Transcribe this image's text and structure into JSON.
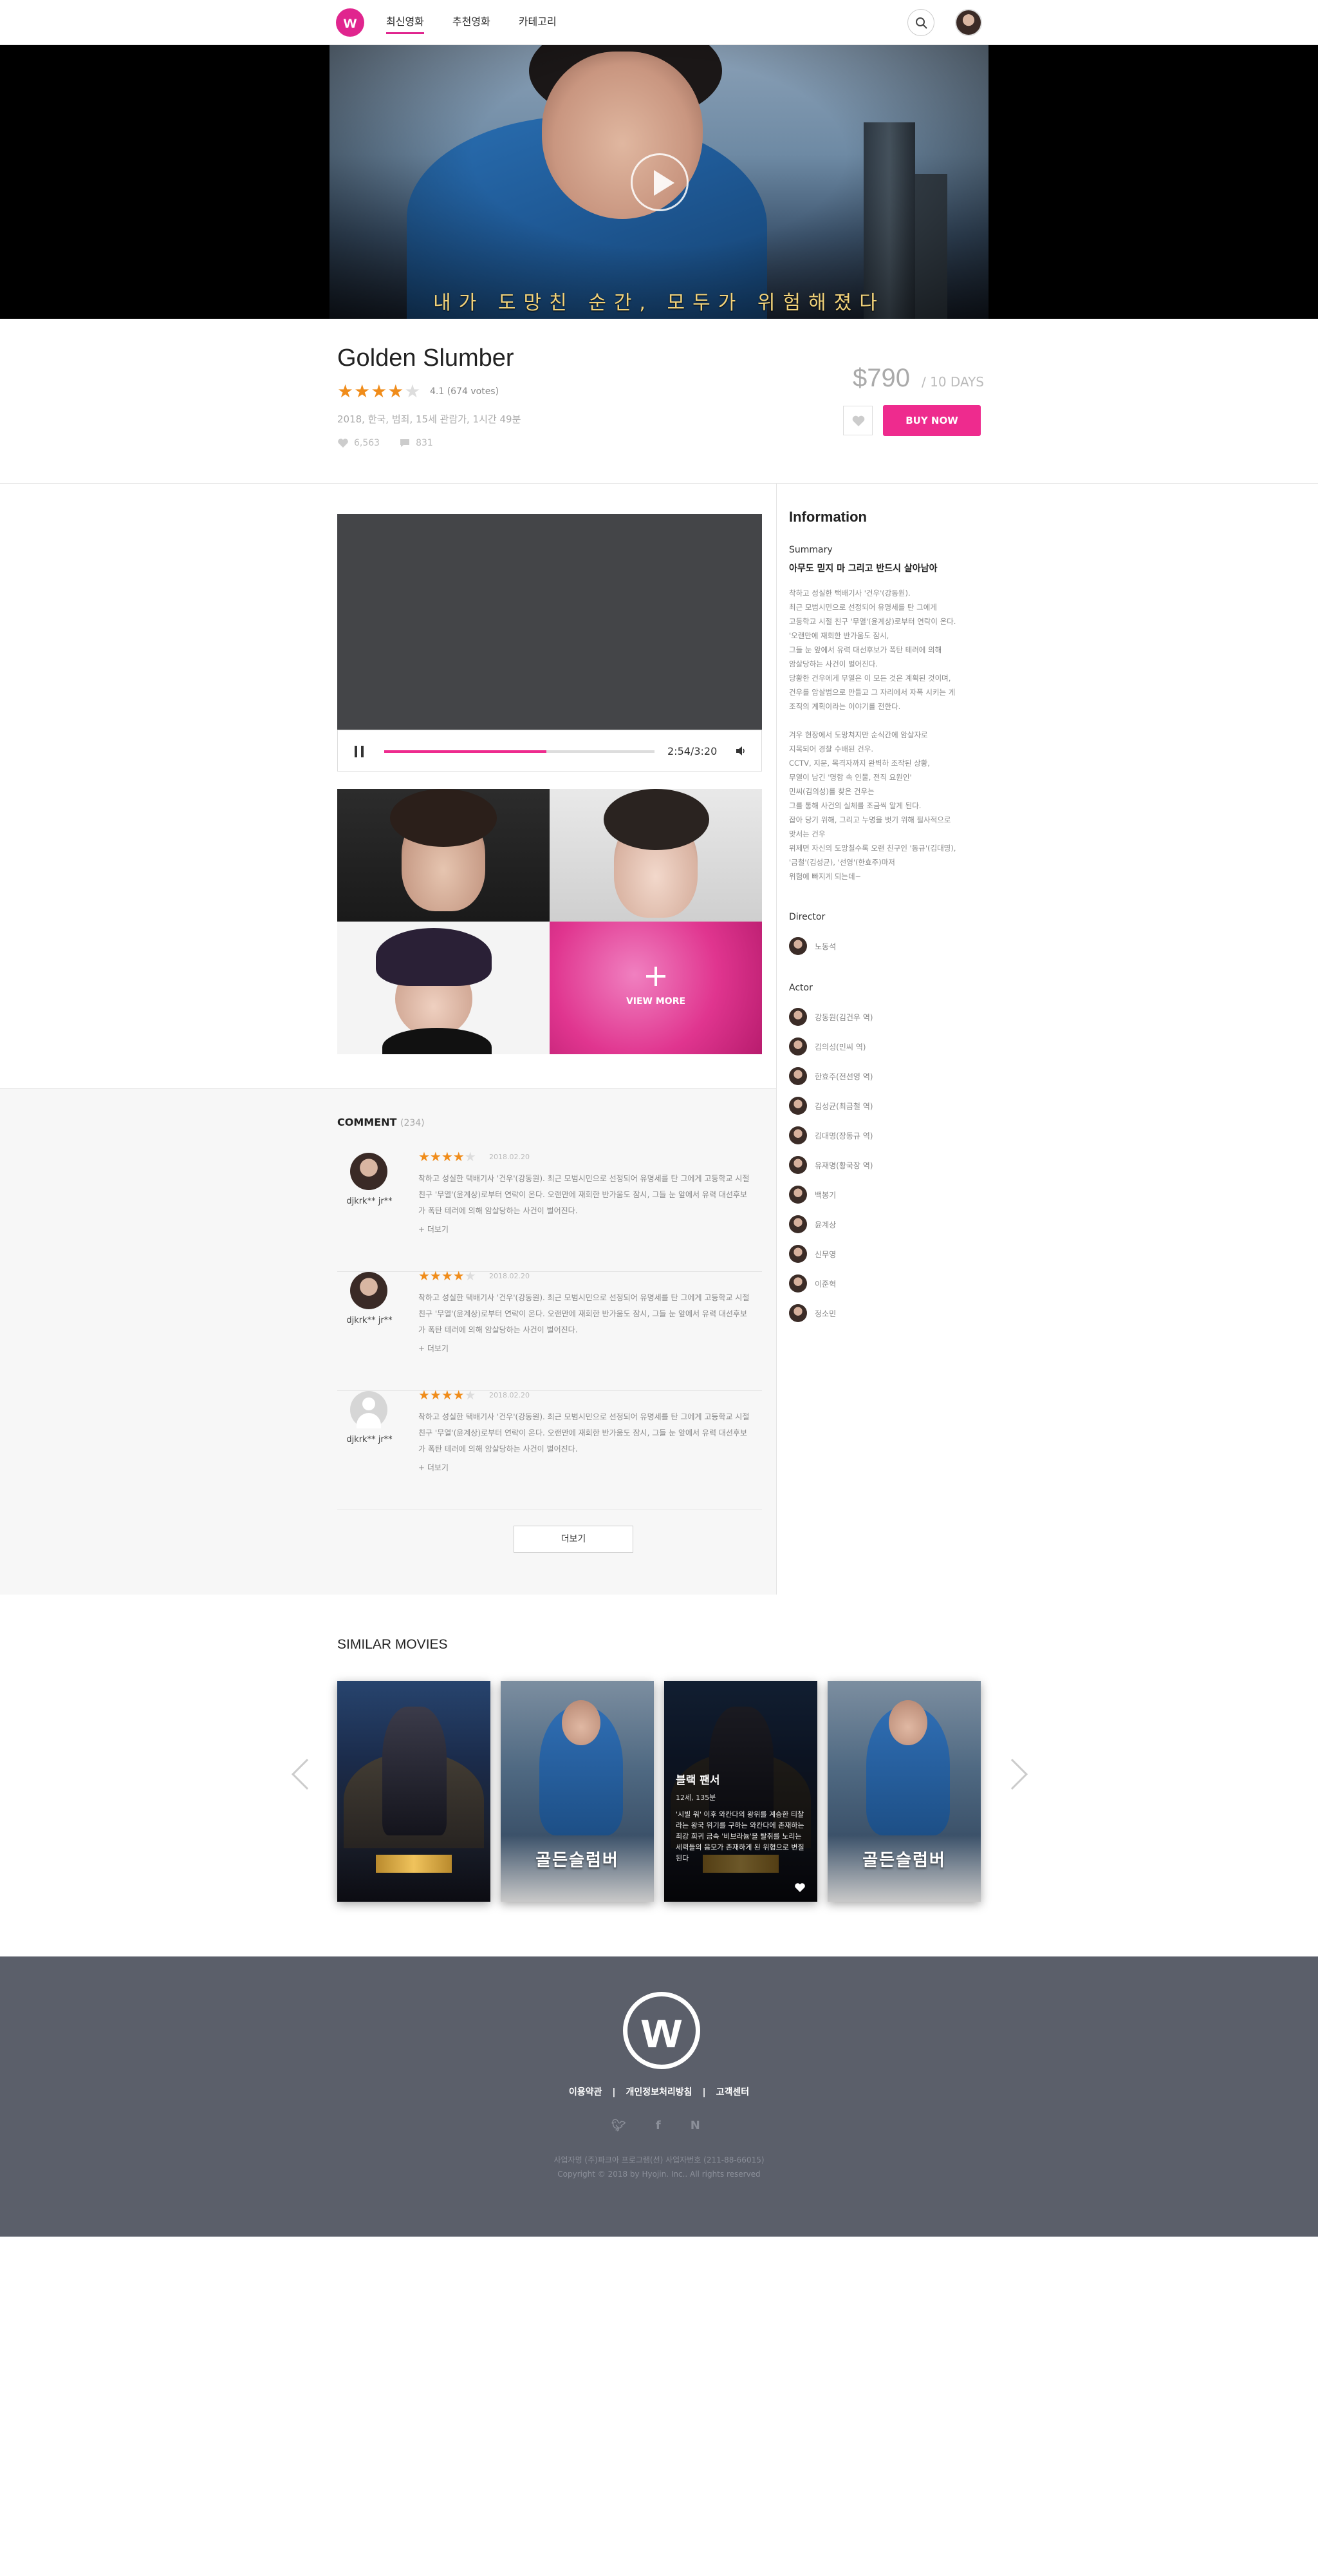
{
  "header": {
    "logo_text": "w",
    "nav": [
      "최신영화",
      "추천영화",
      "카테고리"
    ],
    "active_nav": "최신영화"
  },
  "hero": {
    "subtitle": "내가 도망친 순간, 모두가 위험해졌다"
  },
  "movie": {
    "title": "Golden Slumber",
    "stars_filled": 4,
    "stars_total": 5,
    "rating_text": "4.1 (674 votes)",
    "meta": "2018, 한국, 범죄, 15세 관람가, 1시간 49분",
    "likes": "6,563",
    "comments": "831",
    "price": "$790",
    "price_unit": "/ 10 DAYS",
    "buy_label": "BUY NOW"
  },
  "player": {
    "time": "2:54/3:20",
    "progress": 0.6
  },
  "gallery": {
    "more_label": "VIEW MORE"
  },
  "info": {
    "title": "Information",
    "summary_label": "Summary",
    "summary_heading": "아무도 믿지 마 그리고 반드시 살아남아",
    "summary_body": "착하고 성실한 택배기사 '건우'(강동원).\n 최근 모범시민으로 선정되어 유명세를 탄 그에게\n고등학교 시절 친구 '무열'(윤계상)로부터 연락이 온다.\n'오랜만에 재회한 반가움도 잠시,\n그들 눈 앞에서 유력 대선후보가 폭탄 테러에 의해\n암살당하는 사건이 벌어진다.\n당황한 건우에게 무열은 이 모든 것은 계획된 것이며,\n건우를 암살범으로 만들고 그 자리에서 자폭 시키는 게\n조직의 계획이라는 이야기를 전한다.\n\n 겨우 현장에서 도망쳐지만 순식간에 암살자로\n지목되어 경찰 수배된 건우.\n CCTV, 지문, 목격자까지 완벽하 조작된 상황,\n 무열이 남긴 '명함 속 인물, 전직 요원인'\n민씨(김의성)를 찾은 건우는\n 그를 통해 사건의 실체를 조금씩 알게 된다.\n 잡아 당기 위해, 그리고 누명을 벗기 위해 필사적으로\n맞서는 건우\n 위제면 자신의 도망칠수록 오랜 친구인 '동규'(김대명),\n'금철'(김성균), '선영'(한효주)마저\n 위험에 빠지게 되는데~",
    "director_label": "Director",
    "directors": [
      "노동석"
    ],
    "actor_label": "Actor",
    "actors": [
      "강동원(김건우 역)",
      "김의성(민씨 역)",
      "한효주(전선영 역)",
      "김성균(최금철 역)",
      "김대명(장동규 역)",
      "유재명(황국장 역)",
      "백봉기",
      "윤계상",
      "신무영",
      "이준혁",
      "정소민"
    ]
  },
  "comments_section": {
    "label": "COMMENT",
    "count": "(234)",
    "items": [
      {
        "user": "djkrk** jr**",
        "stars": 4,
        "date": "2018.02.20",
        "text": "착하고 성실한 택배기사 '건우'(강동원).  최근 모범시민으로 선정되어 유명세를 탄 그에게 고등학교 시절 친구 '무열'(윤계상)로부터 연락이 온다. 오랜만에 재회한 반가움도 잠시, 그들 눈 앞에서 유력 대선후보가 폭탄 테러에 의해 암살당하는 사건이 벌어진다.",
        "more": "+ 더보기",
        "avatar": "photo"
      },
      {
        "user": "djkrk** jr**",
        "stars": 4,
        "date": "2018.02.20",
        "text": "착하고 성실한 택배기사 '건우'(강동원).  최근 모범시민으로 선정되어 유명세를 탄 그에게 고등학교 시절 친구 '무열'(윤계상)로부터 연락이 온다. 오랜만에 재회한 반가움도 잠시, 그들 눈 앞에서 유력 대선후보가 폭탄 테러에 의해 암살당하는 사건이 벌어진다.",
        "more": "+ 더보기",
        "avatar": "photo"
      },
      {
        "user": "djkrk** jr**",
        "stars": 4,
        "date": "2018.02.20",
        "text": "착하고 성실한 택배기사 '건우'(강동원).  최근 모범시민으로 선정되어 유명세를 탄 그에게 고등학교 시절 친구 '무열'(윤계상)로부터 연락이 온다. 오랜만에 재회한 반가움도 잠시, 그들 눈 앞에서 유력 대선후보가 폭탄 테러에 의해 암살당하는 사건이 벌어진다.",
        "more": "+ 더보기",
        "avatar": "default"
      }
    ],
    "load_more": "더보기"
  },
  "similar": {
    "title": "SIMILAR MOVIES",
    "posters": [
      {
        "style": "bp",
        "title_art": ""
      },
      {
        "style": "gs",
        "title_art": "골든슬럼버"
      },
      {
        "style": "bp",
        "title_art": "",
        "hover": true,
        "overlay_title": "블랙 팬서",
        "overlay_meta": "12세, 135분",
        "overlay_desc": "'시빌 워' 이후 와칸다의 왕위를 계승한 티찰라는 왕국 위기를 구하는 와칸다에 존재하는 최강 희귀 금속 '비브라늄'을 탈취를 노리는 세력들의 음모가 존재하게 된 위협으로 변질된다"
      },
      {
        "style": "gs",
        "title_art": "골든슬럼버"
      }
    ]
  },
  "footer": {
    "links": [
      "이용약관",
      "개인정보처리방침",
      "고객센터"
    ],
    "separator": "|",
    "sns": [
      "twitter-icon",
      "facebook-icon",
      "naver-icon"
    ],
    "company": "사업자명 (주)파크아 프로그램(선) 사업자번호 (211-88-66015)",
    "copyright": "Copyright © 2018 by Hyojin. Inc.. All rights reserved"
  },
  "colors": {
    "accent": "#ee2b8e",
    "star": "#f08c1a",
    "footer_bg": "#5b5f6a"
  }
}
